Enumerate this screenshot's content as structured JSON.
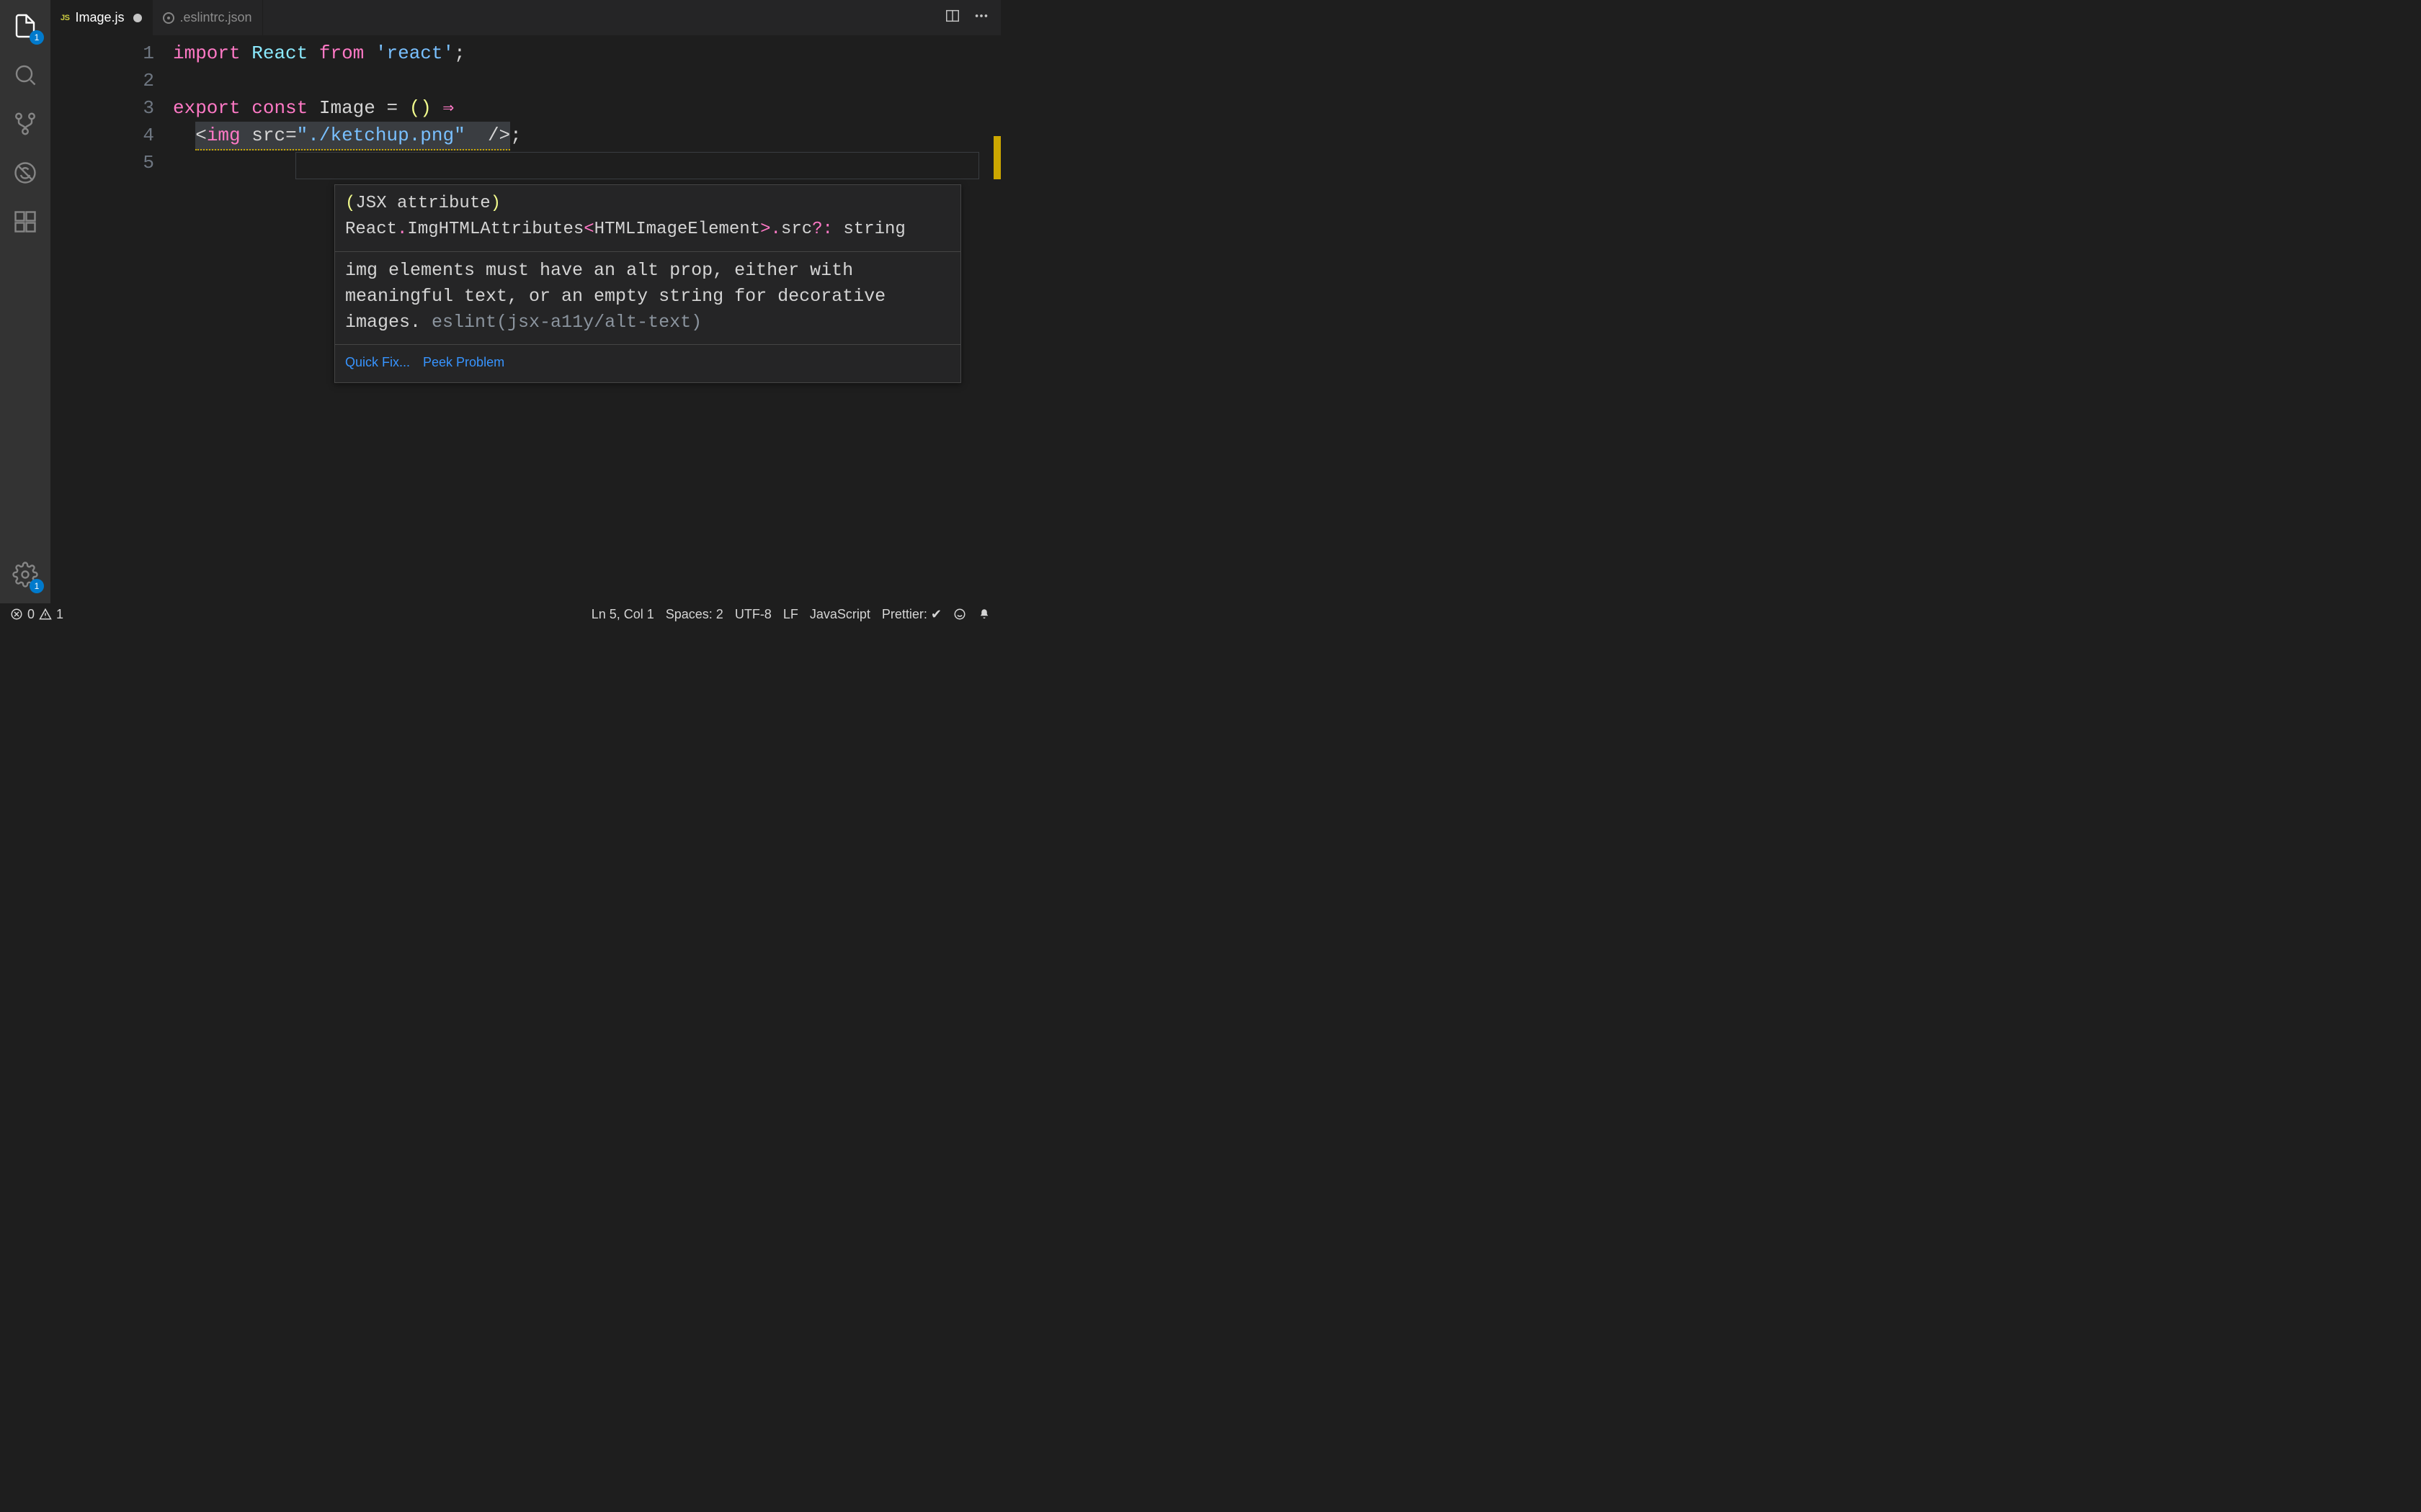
{
  "activity_bar": {
    "explorer_badge": "1",
    "settings_badge": "1"
  },
  "tabs": {
    "active": {
      "icon": "JS",
      "title": "Image.js",
      "dirty": true
    },
    "inactive": {
      "title": ".eslintrc.json"
    }
  },
  "gutter": [
    "1",
    "2",
    "3",
    "4",
    "5"
  ],
  "code": {
    "line1": {
      "import": "import",
      "react": "React",
      "from": "from",
      "str": "'react'",
      "semi": ";"
    },
    "line3": {
      "export": "export",
      "const": "const",
      "name": "Image",
      "eq": " = ",
      "lp": "(",
      "rp": ")",
      "arrow": " ⇒"
    },
    "line4": {
      "indent": "  ",
      "open": "<",
      "tag": "img",
      "sp1": " ",
      "attr": "src",
      "eq": "=",
      "str": "\"./ketchup.png\"",
      "sp2": "  ",
      "close": "/>",
      "semi": ";"
    }
  },
  "hover": {
    "sig": {
      "lp": "(",
      "jsx": "JSX attribute",
      "rp": ") ",
      "react": "React",
      "dot1": ".",
      "type": "ImgHTMLAttributes",
      "lt": "<",
      "elem": "HTMLImageElement",
      "gt": ">",
      "dot2": ".",
      "prop": "src",
      "opt": "?:",
      "rest": "  string"
    },
    "msg": "img elements must have an alt prop, either with meaningful text, or an empty string for decorative images. ",
    "rule": "eslint(jsx-a11y/alt-text)",
    "quick_fix": "Quick Fix...",
    "peek": "Peek Problem"
  },
  "status": {
    "errors": "0",
    "warnings": "1",
    "ln_col": "Ln 5, Col 1",
    "spaces": "Spaces: 2",
    "encoding": "UTF-8",
    "eol": "LF",
    "language": "JavaScript",
    "prettier": "Prettier: ✔"
  }
}
